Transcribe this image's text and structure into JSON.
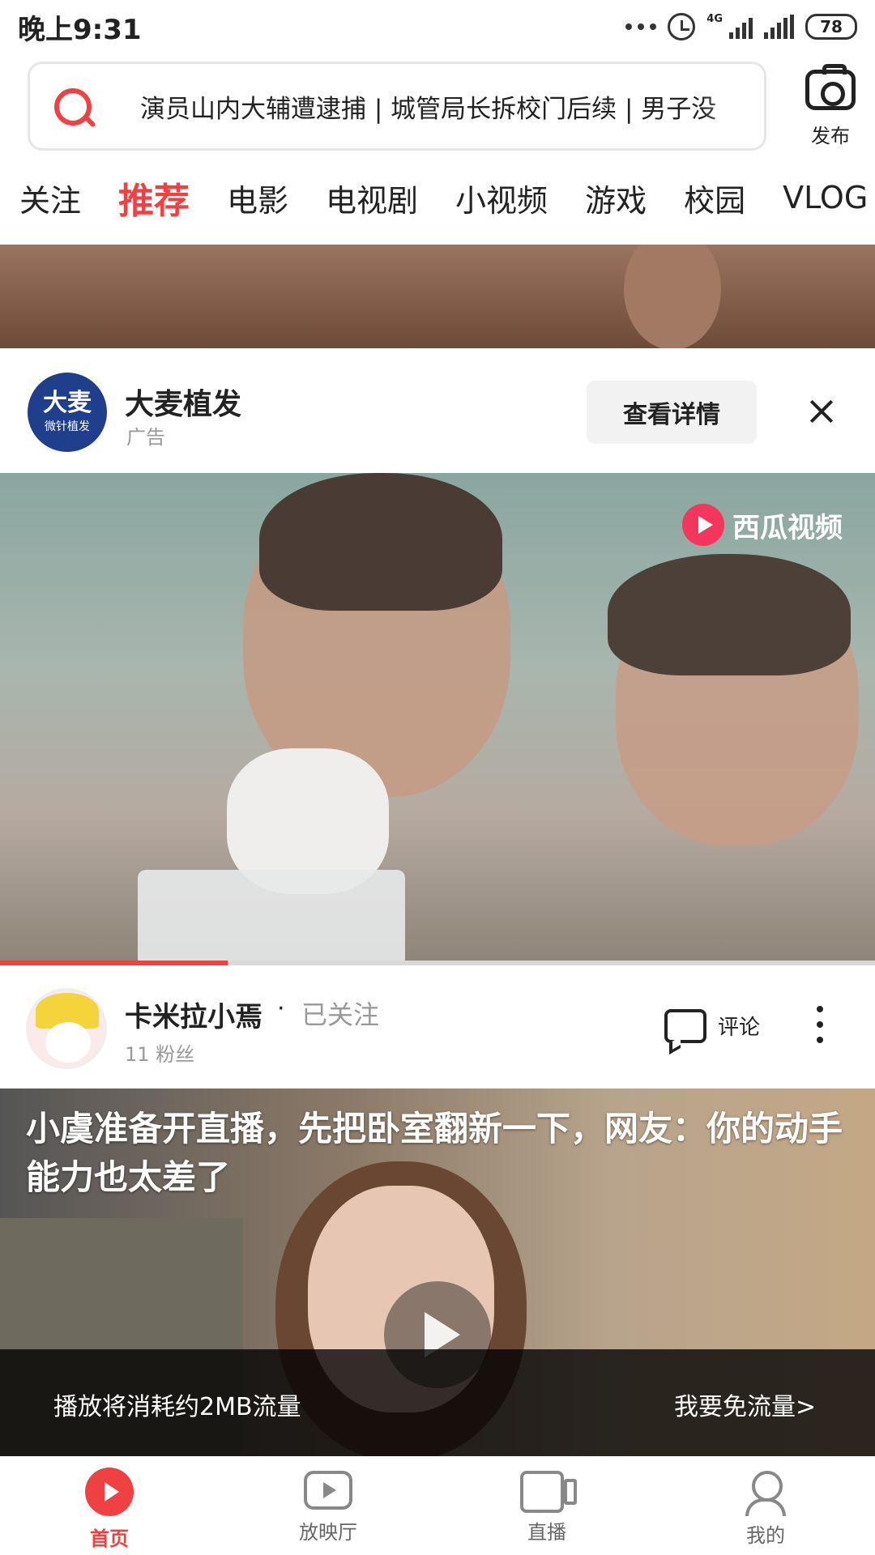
{
  "status_bar": {
    "time": "晚上9:31",
    "network": "4G",
    "battery": "78"
  },
  "search": {
    "hot_text": "演员山内大辅遭逮捕 | 城管局长拆校门后续 | 男子没",
    "publish_label": "发布"
  },
  "tabs": [
    {
      "label": "关注",
      "active": false
    },
    {
      "label": "推荐",
      "active": true
    },
    {
      "label": "电影",
      "active": false
    },
    {
      "label": "电视剧",
      "active": false
    },
    {
      "label": "小视频",
      "active": false
    },
    {
      "label": "游戏",
      "active": false
    },
    {
      "label": "校园",
      "active": false
    },
    {
      "label": "VLOG",
      "active": false
    }
  ],
  "ad": {
    "avatar_big": "大麦",
    "avatar_small": "微针植发",
    "name": "大麦植发",
    "tag": "广告",
    "detail_button": "查看详情"
  },
  "video1": {
    "watermark": "西瓜视频",
    "progress_fraction": 0.26
  },
  "author": {
    "name": "卡米拉小焉",
    "separator": "·",
    "follow_status": "已关注",
    "fans": "11 粉丝",
    "comment_label": "评论"
  },
  "video2": {
    "title": "小虞准备开直播，先把卧室翻新一下，网友：你的动手能力也太差了",
    "data_notice": "播放将消耗约2MB流量",
    "free_data_link": "我要免流量>"
  },
  "bottom_nav": [
    {
      "label": "首页",
      "icon": "home-icon",
      "active": true
    },
    {
      "label": "放映厅",
      "icon": "cinema-icon",
      "active": false
    },
    {
      "label": "直播",
      "icon": "live-icon",
      "active": false
    },
    {
      "label": "我的",
      "icon": "me-icon",
      "active": false
    }
  ],
  "colors": {
    "accent": "#f04142"
  }
}
